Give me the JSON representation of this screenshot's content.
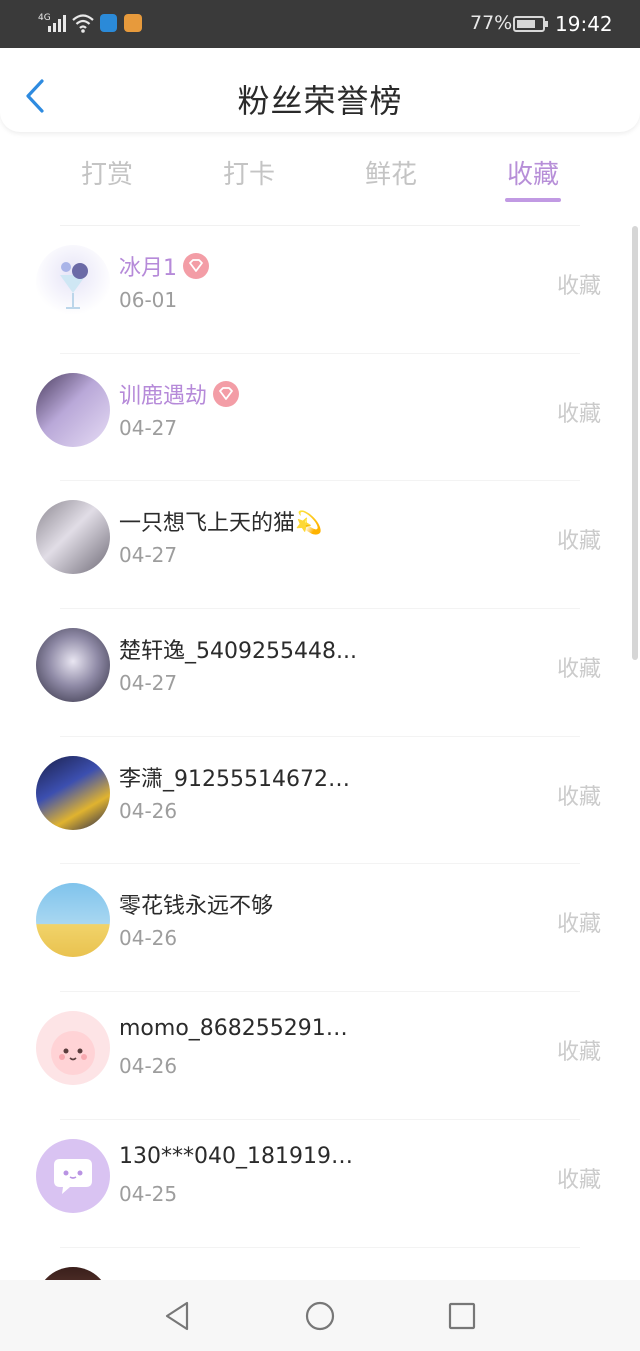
{
  "status_bar": {
    "network": "4G",
    "battery_percent": "77%",
    "battery_level": 0.77,
    "time": "19:42"
  },
  "header": {
    "title": "粉丝荣誉榜",
    "back_icon": "chevron-left-icon"
  },
  "tabs": [
    {
      "label": "打赏",
      "active": false
    },
    {
      "label": "打卡",
      "active": false
    },
    {
      "label": "鲜花",
      "active": false
    },
    {
      "label": "收藏",
      "active": true
    }
  ],
  "colors": {
    "accent": "#b78fd8",
    "vip_name": "#b68ad9",
    "badge": "#f39da6",
    "muted": "#cbcbcb"
  },
  "fans": [
    {
      "name": "冰月1",
      "date": "06-01",
      "action": "收藏",
      "vip": true
    },
    {
      "name": "训鹿遇劫",
      "date": "04-27",
      "action": "收藏",
      "vip": true
    },
    {
      "name": "一只想飞上天的猫💫",
      "date": "04-27",
      "action": "收藏",
      "vip": false
    },
    {
      "name": "楚轩逸_5409255448...",
      "date": "04-27",
      "action": "收藏",
      "vip": false
    },
    {
      "name": "李潇_912555146727...",
      "date": "04-26",
      "action": "收藏",
      "vip": false
    },
    {
      "name": "零花钱永远不够",
      "date": "04-26",
      "action": "收藏",
      "vip": false
    },
    {
      "name": "momo_8682552918...",
      "date": "04-26",
      "action": "收藏",
      "vip": false
    },
    {
      "name": "130***040_1819196...",
      "date": "04-25",
      "action": "收藏",
      "vip": false
    },
    {
      "name": "",
      "date": "",
      "action": "",
      "vip": false
    }
  ],
  "bottom_nav": {
    "back": "triangle-back-icon",
    "home": "circle-home-icon",
    "recents": "square-recents-icon"
  }
}
